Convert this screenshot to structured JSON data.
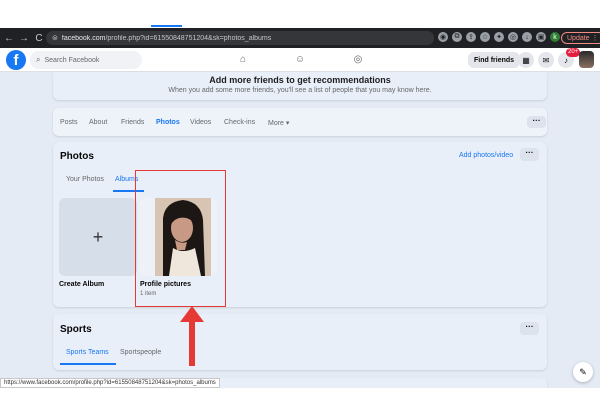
{
  "browser": {
    "back": "←",
    "forward": "→",
    "reload": "C",
    "url_host": "facebook.com",
    "url_path": "/profile.php?id=61550848751204&sk=photos_albums",
    "update_label": "Update"
  },
  "header": {
    "logo": "f",
    "search_placeholder": "Search Facebook",
    "find_friends": "Find friends",
    "notification_count": "20+"
  },
  "recommendations": {
    "title": "Add more friends to get recommendations",
    "subtitle": "When you add some more friends, you'll see a list of people that you may know here."
  },
  "profile_tabs": {
    "items": [
      "Posts",
      "About",
      "Friends",
      "Photos",
      "Videos",
      "Check-ins",
      "More ▾"
    ],
    "active": "Photos",
    "more_button": "···"
  },
  "photos": {
    "title": "Photos",
    "add_link": "Add photos/video",
    "more_button": "···",
    "sub_tabs": [
      "Your Photos",
      "Albums"
    ],
    "active_sub_tab": "Albums",
    "create_album_label": "Create Album",
    "create_plus": "+",
    "albums": [
      {
        "name": "Profile pictures",
        "count": "1 item"
      }
    ]
  },
  "sports": {
    "title": "Sports",
    "more_button": "···",
    "tabs": [
      "Sports Teams",
      "Sportspeople"
    ],
    "active_tab": "Sports Teams"
  },
  "status_bar": {
    "url": "https://www.facebook.com/profile.php?id=61550848751204&sk=photos_albums"
  },
  "colors": {
    "accent": "#1877f2",
    "highlight": "#e53935",
    "arrow": "#e53935"
  }
}
